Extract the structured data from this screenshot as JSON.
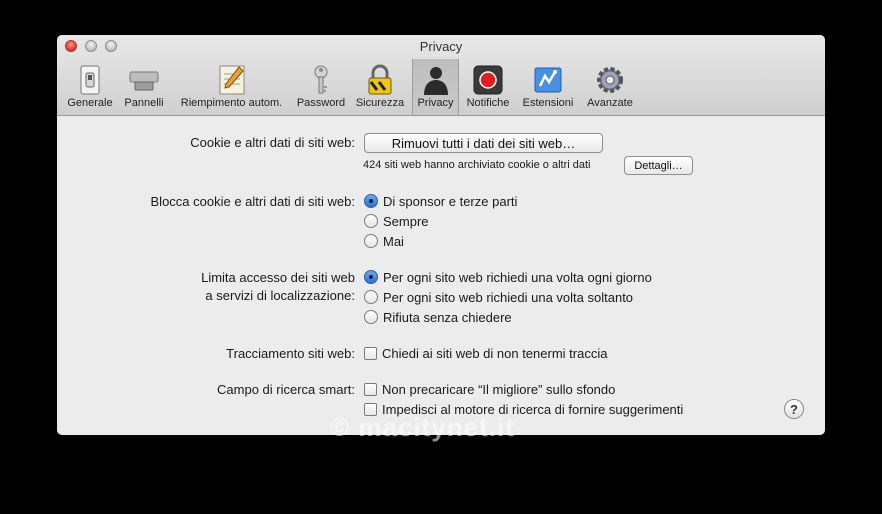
{
  "window": {
    "title": "Privacy"
  },
  "toolbar": {
    "items": [
      {
        "label": "Generale",
        "icon": "switch-icon"
      },
      {
        "label": "Pannelli",
        "icon": "tabs-icon"
      },
      {
        "label": "Riempimento autom.",
        "icon": "pencil-form-icon"
      },
      {
        "label": "Password",
        "icon": "key-icon"
      },
      {
        "label": "Sicurezza",
        "icon": "padlock-icon"
      },
      {
        "label": "Privacy",
        "icon": "person-silhouette-icon"
      },
      {
        "label": "Notifiche",
        "icon": "notification-record-icon"
      },
      {
        "label": "Estensioni",
        "icon": "puzzle-icon"
      },
      {
        "label": "Avanzate",
        "icon": "gear-icon"
      }
    ],
    "selected": "Privacy"
  },
  "cookies": {
    "label": "Cookie e altri dati di siti web:",
    "remove_button": "Rimuovi tutti i dati dei siti web…",
    "info": "424 siti web hanno archiviato cookie o altri dati",
    "details_button": "Dettagli…"
  },
  "block": {
    "label": "Blocca cookie e altri dati di siti web:",
    "options": [
      "Di sponsor e terze parti",
      "Sempre",
      "Mai"
    ],
    "selected": "Di sponsor e terze parti"
  },
  "location": {
    "label_line1": "Limita accesso dei siti web",
    "label_line2": "a servizi di localizzazione:",
    "options": [
      "Per ogni sito web richiedi una volta ogni giorno",
      "Per ogni sito web richiedi una volta soltanto",
      "Rifiuta senza chiedere"
    ],
    "selected": "Per ogni sito web richiedi una volta ogni giorno"
  },
  "tracking": {
    "label": "Tracciamento siti web:",
    "option": "Chiedi ai siti web di non tenermi traccia",
    "checked": false
  },
  "smart_search": {
    "label": "Campo di ricerca smart:",
    "options": [
      "Non precaricare “Il migliore” sullo sfondo",
      "Impedisci al motore di ricerca di fornire suggerimenti"
    ],
    "checked": [
      false,
      false
    ]
  },
  "help": {
    "label": "?"
  },
  "watermark": "© macitynet.it",
  "colors": {
    "radio_selected": "#2d73d4",
    "close_button": "#e0433a",
    "record_red": "#e02020"
  }
}
